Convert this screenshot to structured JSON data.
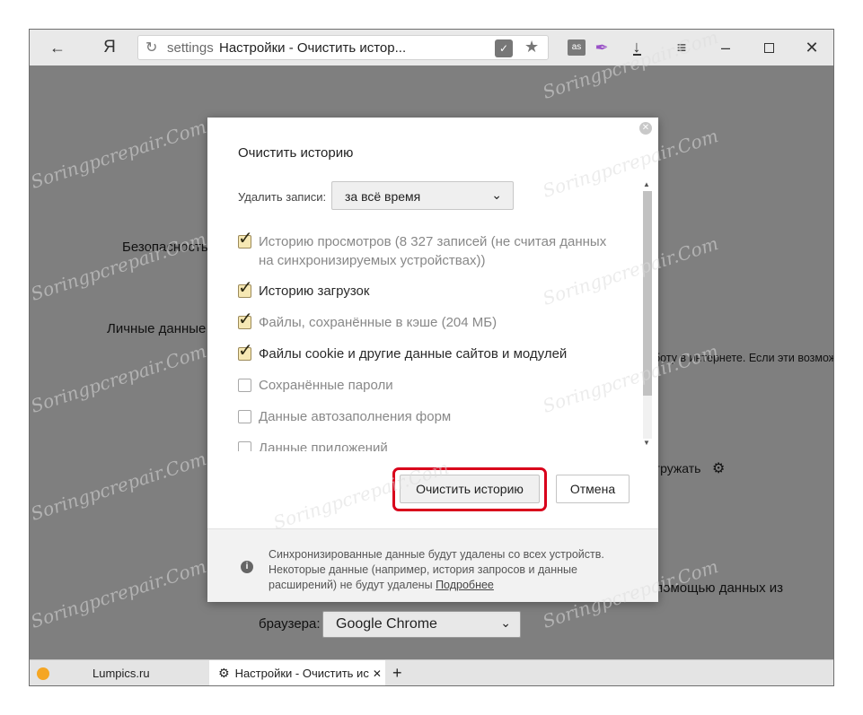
{
  "browser": {
    "back_icon": "arrow-left-icon",
    "logo": "Я",
    "address": {
      "scheme": "settings",
      "page_title": "Настройки - Очистить истор...",
      "reload_icon": "reload-icon",
      "protect_icon": "shield-icon",
      "bookmark_icon": "star-icon"
    },
    "extensions": [
      "lastfm-icon",
      "feather-icon"
    ],
    "download_icon": "download-icon",
    "menu_icon": "hamburger-icon",
    "window_controls": [
      "minimize-icon",
      "maximize-icon",
      "close-icon"
    ]
  },
  "background": {
    "security_label": "Безопасность",
    "personal_label": "Личные данные",
    "personal_desc": "боту в интернете. Если эти возмож",
    "load_text": "гружать",
    "import_text": "помощью данных из",
    "browser_label": "браузера:",
    "browser_select": "Google Chrome"
  },
  "dialog": {
    "title": "Очистить историю",
    "period_label": "Удалить записи:",
    "period_value": "за всё время",
    "items": [
      {
        "label": "Историю просмотров",
        "sub": "(8 327 записей (не считая данных",
        "sub2": "на синхронизируемых устройствах))",
        "checked": true
      },
      {
        "label": "Историю загрузок",
        "checked": true
      },
      {
        "label": "Файлы, сохранённые в кэше",
        "sub": "(204 МБ)",
        "checked": true
      },
      {
        "label": "Файлы cookie и другие данные сайтов и модулей",
        "checked": true
      },
      {
        "label": "Сохранённые пароли",
        "checked": false
      },
      {
        "label": "Данные автозаполнения форм",
        "checked": false
      },
      {
        "label": "Данные приложений",
        "checked": false
      }
    ],
    "clear_button": "Очистить историю",
    "cancel_button": "Отмена",
    "footer_line1": "Синхронизированные данные будут удалены со всех устройств.",
    "footer_line2": "Некоторые данные (например, история запросов и данные",
    "footer_line3": "расширений) не будут удалены",
    "footer_link": "Подробнее"
  },
  "tabs": [
    {
      "label": "Lumpics.ru",
      "icon": "orange-icon"
    },
    {
      "label": "Настройки - Очистить ис",
      "icon": "gear-icon",
      "active": true
    }
  ],
  "watermark": "Soringpcrepair.Com"
}
